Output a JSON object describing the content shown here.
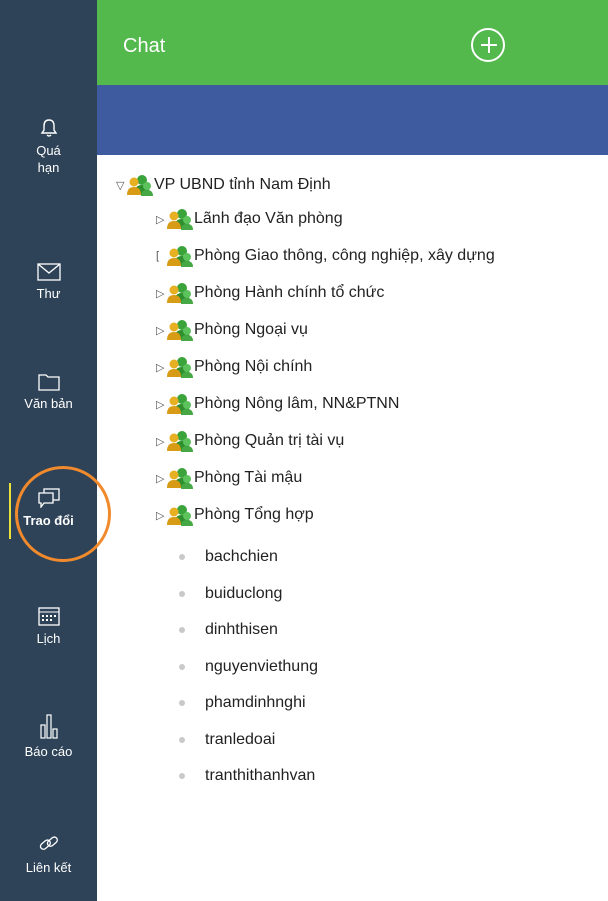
{
  "header": {
    "title": "Chat",
    "add_icon": "plus-circle-icon"
  },
  "sidebar": {
    "items": [
      {
        "label_line1": "Quá",
        "label_line2": "hạn",
        "icon": "bell-icon"
      },
      {
        "label": "Thư",
        "icon": "mail-icon"
      },
      {
        "label": "Văn bản",
        "icon": "folder-icon"
      },
      {
        "label": "Trao đổi",
        "icon": "chat-icon",
        "active": true
      },
      {
        "label": "Lịch",
        "icon": "calendar-icon"
      },
      {
        "label": "Báo cáo",
        "icon": "bar-chart-icon"
      },
      {
        "label": "Liên kết",
        "icon": "link-icon"
      }
    ]
  },
  "tree": {
    "root": "VP UBND tỉnh Nam Định",
    "groups": [
      "Lãnh đạo Văn phòng",
      "Phòng Giao thông, công nghiệp, xây dựng",
      "Phòng Hành chính tổ chức",
      "Phòng Ngoại vụ",
      "Phòng Nội chính",
      "Phòng Nông lâm, NN&PTNN",
      "Phòng Quản trị tài vụ",
      "Phòng Tài mậu",
      "Phòng Tổng hợp"
    ],
    "users": [
      "bachchien",
      "buiduclong",
      "dinhthisen",
      "nguyenviethung",
      "phamdinhnghi",
      "tranledoai",
      "tranthithanhvan"
    ]
  },
  "colors": {
    "header": "#53b94c",
    "subheader": "#3e5ba0",
    "sidebar": "#2f4358",
    "highlight": "#f08a2c"
  }
}
